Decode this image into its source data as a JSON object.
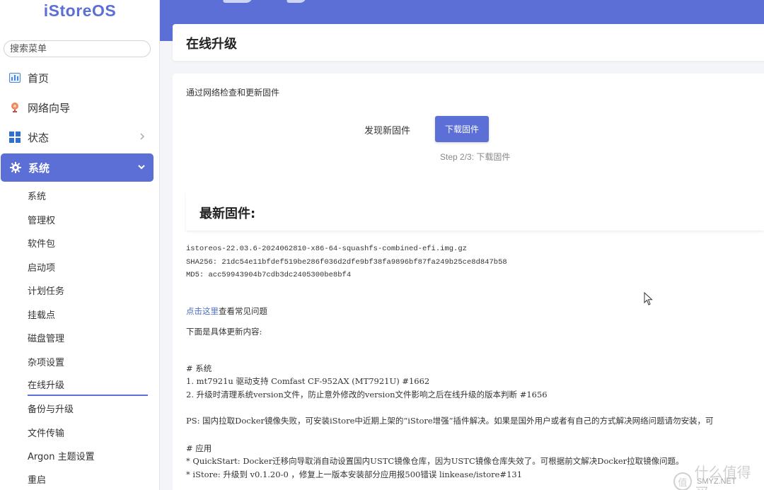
{
  "app": {
    "logo": "iStoreOS",
    "colors": {
      "accent": "#5b6fd6",
      "link": "#4d6fc9"
    }
  },
  "sidebar": {
    "search_placeholder": "搜索菜单",
    "items": [
      {
        "label": "首页",
        "icon": "dashboard-icon"
      },
      {
        "label": "网络向导",
        "icon": "globe-icon"
      },
      {
        "label": "状态",
        "icon": "grid-icon"
      },
      {
        "label": "系统",
        "icon": "gear-icon"
      }
    ],
    "subitems": [
      "系统",
      "管理权",
      "软件包",
      "启动项",
      "计划任务",
      "挂载点",
      "磁盘管理",
      "杂项设置",
      "在线升级",
      "备份与升级",
      "文件传输",
      "Argon 主题设置",
      "重启"
    ]
  },
  "header": {
    "title": "在线升级"
  },
  "main": {
    "section_desc": "通过网络检查和更新固件",
    "found_label": "发现新固件",
    "download_button": "下载固件",
    "step_text": "Step 2/3: 下载固件",
    "latest_title": "最新固件:",
    "filename": "istoreos-22.03.6-2024062810-x86-64-squashfs-combined-efi.img.gz",
    "sha256": "SHA256: 21dc54e11bfdef519be286f036d2dfe9bf38fa9896bf87fa249b25ce8d847b58",
    "md5": "MD5: acc59943904b7cdb3dc2405300be8bf4",
    "faq_link": "点击这里",
    "faq_text": "查看常见问题",
    "changes_intro": "下面是具体更新内容:",
    "sys_heading": "# 系统",
    "sys_line1": "1. mt7921u 驱动支持 Comfast CF-952AX (MT7921U)  #1662",
    "sys_line2": "2. 升级时清理系统version文件，防止意外修改的version文件影响之后在线升级的版本判断 #1656",
    "ps_line": "PS: 国内拉取Docker镜像失败，可安装iStore中近期上架的“iStore增强”插件解决。如果是国外用户或者有自己的方式解决网络问题请勿安装，可",
    "app_heading": "# 应用",
    "app_line1": "* QuickStart: Docker迁移向导取消自动设置国内USTC镜像仓库，因为USTC镜像仓库失效了。可根据前文解决Docker拉取镜像问题。",
    "app_line2": "* iStore: 升级到 v0.1.20-0 ，修复上一版本安装部分应用报500错误 linkease/istore#131"
  },
  "watermark": {
    "text": "什么值得买",
    "circle": "值",
    "sub": "SMYZ.NET"
  }
}
